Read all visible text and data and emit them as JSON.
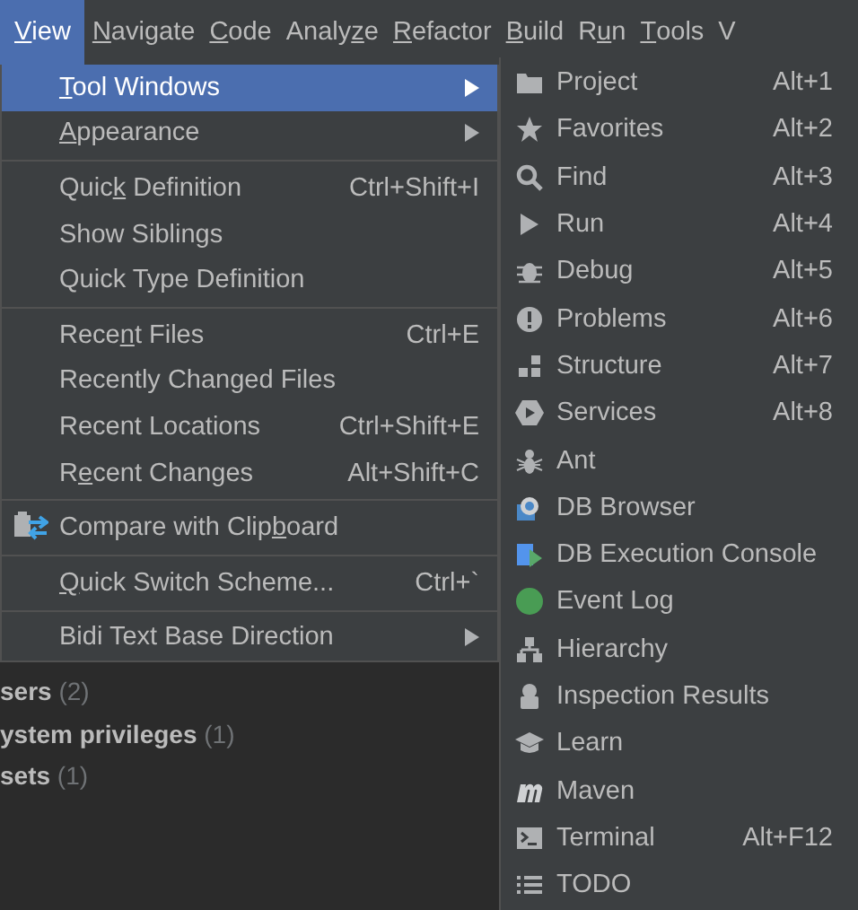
{
  "menubar": [
    {
      "label": {
        "key": "V",
        "after": "iew"
      },
      "selected": true
    },
    {
      "label": {
        "key": "N",
        "after": "avigate"
      },
      "selected": false
    },
    {
      "label": {
        "key": "C",
        "after": "ode"
      },
      "selected": false
    },
    {
      "label": {
        "before": "Analy",
        "key": "z",
        "after": "e"
      },
      "selected": false
    },
    {
      "label": {
        "key": "R",
        "after": "efactor"
      },
      "selected": false
    },
    {
      "label": {
        "key": "B",
        "after": "uild"
      },
      "selected": false
    },
    {
      "label": {
        "before": "R",
        "key": "u",
        "after": "n"
      },
      "selected": false
    },
    {
      "label": {
        "key": "T",
        "after": "ools"
      },
      "selected": false
    },
    {
      "label": "V",
      "selected": false
    }
  ],
  "view_menu": [
    [
      {
        "label": {
          "key": "T",
          "after": "ool Windows"
        },
        "submenu": true,
        "selected": true
      },
      {
        "label": {
          "key": "A",
          "after": "ppearance"
        },
        "submenu": true,
        "selected": false
      }
    ],
    [
      {
        "label": {
          "before": "Quic",
          "key": "k",
          "after": " Definition"
        },
        "shortcut": "Ctrl+Shift+I",
        "selected": false
      },
      {
        "label": "Show Siblings",
        "selected": false
      },
      {
        "label": "Quick Type Definition",
        "selected": false
      }
    ],
    [
      {
        "label": {
          "before": "Rece",
          "key": "n",
          "after": "t Files"
        },
        "shortcut": "Ctrl+E",
        "selected": false
      },
      {
        "label": "Recently Changed Files",
        "selected": false
      },
      {
        "label": "Recent Locations",
        "shortcut": "Ctrl+Shift+E",
        "selected": false
      },
      {
        "label": {
          "before": "R",
          "key": "e",
          "after": "cent Changes"
        },
        "shortcut": "Alt+Shift+C",
        "selected": false
      }
    ],
    [
      {
        "label": {
          "before": "Compare with Clip",
          "key": "b",
          "after": "oard"
        },
        "selected": false
      }
    ],
    [
      {
        "label": {
          "key": "Q",
          "after": "uick Switch Scheme..."
        },
        "shortcut": "Ctrl+`",
        "selected": false
      }
    ],
    [
      {
        "label": "Bidi Text Base Direction",
        "submenu": true,
        "selected": false
      }
    ]
  ],
  "tool_windows": [
    {
      "label": "Project",
      "shortcut": "Alt+1"
    },
    {
      "label": "Favorites",
      "shortcut": "Alt+2"
    },
    {
      "label": "Find",
      "shortcut": "Alt+3"
    },
    {
      "label": "Run",
      "shortcut": "Alt+4"
    },
    {
      "label": "Debug",
      "shortcut": "Alt+5"
    },
    {
      "label": "Problems",
      "shortcut": "Alt+6"
    },
    {
      "label": "Structure",
      "shortcut": "Alt+7"
    },
    {
      "label": "Services",
      "shortcut": "Alt+8"
    },
    {
      "label": "Ant"
    },
    {
      "label": "DB Browser"
    },
    {
      "label": "DB Execution Console"
    },
    {
      "label": "Event Log"
    },
    {
      "label": "Hierarchy"
    },
    {
      "label": "Inspection Results"
    },
    {
      "label": "Learn"
    },
    {
      "label": "Maven"
    },
    {
      "label": "Terminal",
      "shortcut": "Alt+F12"
    },
    {
      "label": "TODO"
    }
  ],
  "tree": [
    {
      "name": "sers",
      "count": "(2)"
    },
    {
      "name": "ystem privileges",
      "count": "(1)"
    },
    {
      "name": "sets",
      "count": "(1)"
    }
  ]
}
